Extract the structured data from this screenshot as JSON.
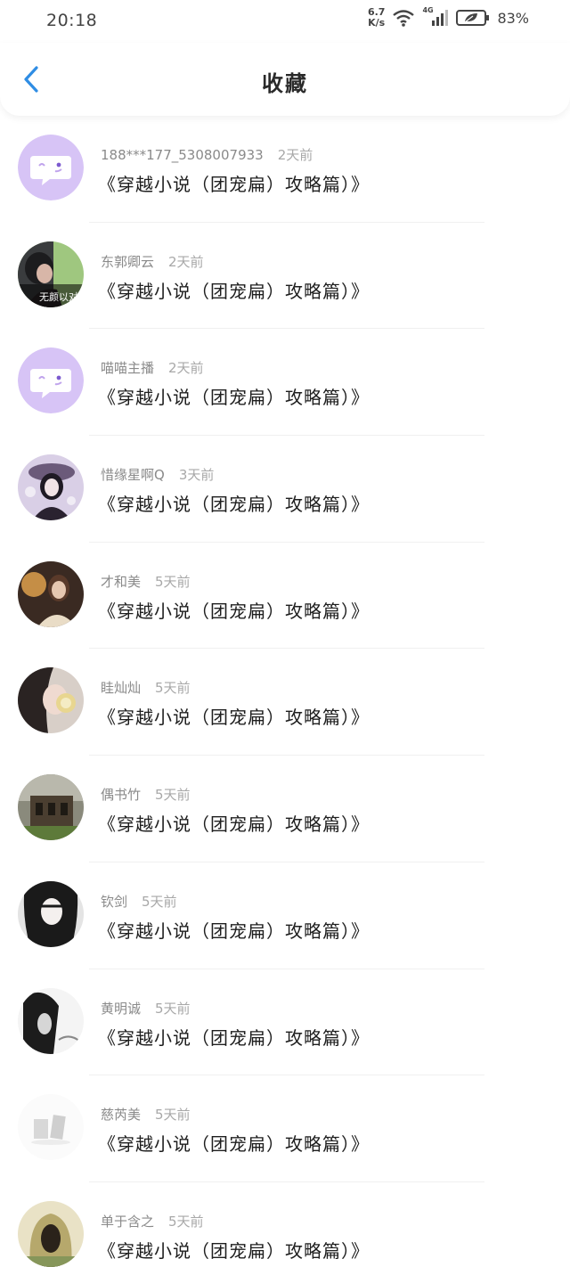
{
  "status": {
    "time": "20:18",
    "net_speed_value": "6.7",
    "net_speed_unit": "K/s",
    "network": "4G",
    "battery": "83%"
  },
  "header": {
    "title": "收藏",
    "back_icon": "chevron-left-icon"
  },
  "accent": "#2f8de4",
  "items": [
    {
      "name": "188***177_5308007933",
      "ago": "2天前",
      "title": "《穿越小说（团宠扁）攻略篇）》",
      "avatar": "chat-bubble-default"
    },
    {
      "name": "东郭卿云",
      "ago": "2天前",
      "title": "《穿越小说（团宠扁）攻略篇）》",
      "avatar": "photo",
      "avatar_text": "无颜以对"
    },
    {
      "name": "喵喵主播",
      "ago": "2天前",
      "title": "《穿越小说（团宠扁）攻略篇）》",
      "avatar": "chat-bubble-default"
    },
    {
      "name": "惜缘星啊Q",
      "ago": "3天前",
      "title": "《穿越小说（团宠扁）攻略篇）》",
      "avatar": "photo"
    },
    {
      "name": "才和美",
      "ago": "5天前",
      "title": "《穿越小说（团宠扁）攻略篇）》",
      "avatar": "photo"
    },
    {
      "name": "眭灿灿",
      "ago": "5天前",
      "title": "《穿越小说（团宠扁）攻略篇）》",
      "avatar": "photo"
    },
    {
      "name": "偶书竹",
      "ago": "5天前",
      "title": "《穿越小说（团宠扁）攻略篇）》",
      "avatar": "photo"
    },
    {
      "name": "钦剑",
      "ago": "5天前",
      "title": "《穿越小说（团宠扁）攻略篇）》",
      "avatar": "photo"
    },
    {
      "name": "黄明诚",
      "ago": "5天前",
      "title": "《穿越小说（团宠扁）攻略篇）》",
      "avatar": "photo"
    },
    {
      "name": "慈芮美",
      "ago": "5天前",
      "title": "《穿越小说（团宠扁）攻略篇）》",
      "avatar": "photo"
    },
    {
      "name": "单于含之",
      "ago": "5天前",
      "title": "《穿越小说（团宠扁）攻略篇）》",
      "avatar": "photo"
    }
  ]
}
